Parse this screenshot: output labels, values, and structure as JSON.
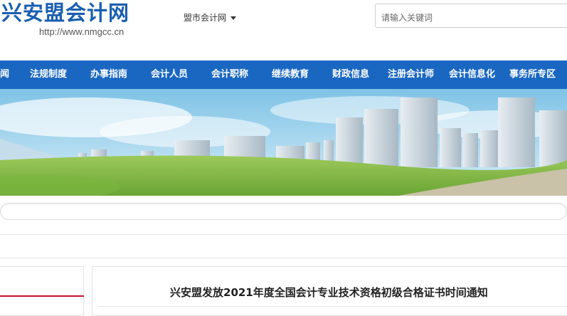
{
  "site": {
    "name": "兴安盟会计网",
    "url": "http://www.nmgcc.cn"
  },
  "city_select": {
    "label": "盟市会计网"
  },
  "search": {
    "placeholder": "请输入关键词"
  },
  "nav": {
    "items": [
      "闻",
      "法规制度",
      "办事指南",
      "会计人员",
      "会计职称",
      "继续教育",
      "财政信息",
      "注册会计师",
      "会计信息化",
      "事务所专区"
    ]
  },
  "article": {
    "title": "兴安盟发放2021年度全国会计专业技术资格初级合格证书时间通知"
  },
  "colors": {
    "brand": "#1a5fb0",
    "nav_bg": "#1a67c2",
    "accent_red": "#c8102e"
  }
}
